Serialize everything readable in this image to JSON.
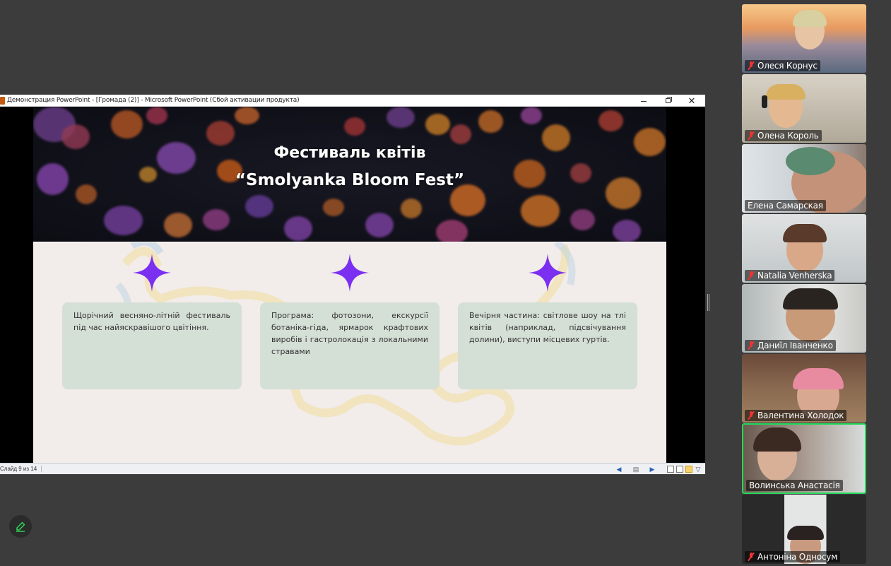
{
  "ppt": {
    "window_title": "Демонстрация PowerPoint - [Громада (2)] - Microsoft PowerPoint (Сбой активации продукта)",
    "minimize_glyph": "—",
    "maximize_glyph": "▢",
    "close_glyph": "✕",
    "slide_counter": "Слайд 9 из 14"
  },
  "slide": {
    "title_line1": "Фестиваль квітів",
    "title_line2": "“Smolyanka Bloom Fest”",
    "cards": [
      {
        "text": "Щорічний весняно-літній фестиваль під час найяскравішого цвітіння."
      },
      {
        "text": "Програма: фотозони, екскурсії ботаніка-гіда, ярмарок крафтових виробів і гастролокація з локальними стравами"
      },
      {
        "text": "Вечірня частина: світлове шоу на тлі квітів (наприклад, підсвічування долини), виступи місцевих гуртів."
      }
    ],
    "star_color": "#7b2ff0",
    "card_color": "#d4dfd6"
  },
  "participants": [
    {
      "name": "Олеся Корнус",
      "muted": true,
      "active": false
    },
    {
      "name": "Олена Король",
      "muted": true,
      "active": false
    },
    {
      "name": "Елена Самарская",
      "muted": false,
      "active": false
    },
    {
      "name": "Natalia Venherska",
      "muted": true,
      "active": false
    },
    {
      "name": "Даниїл Іванченко",
      "muted": true,
      "active": false
    },
    {
      "name": "Валентина Холодок",
      "muted": true,
      "active": false
    },
    {
      "name": "Волинська Анастасія",
      "muted": false,
      "active": true
    },
    {
      "name": "Антоніна Односум",
      "muted": true,
      "active": false
    }
  ],
  "colors": {
    "background": "#3c3c3c",
    "active_speaker_border": "#23d959",
    "mic_muted": "#e33333"
  },
  "icons": {
    "annotate": "pencil-icon",
    "mic_off": "mic-off-icon",
    "star": "four-point-star-icon"
  }
}
